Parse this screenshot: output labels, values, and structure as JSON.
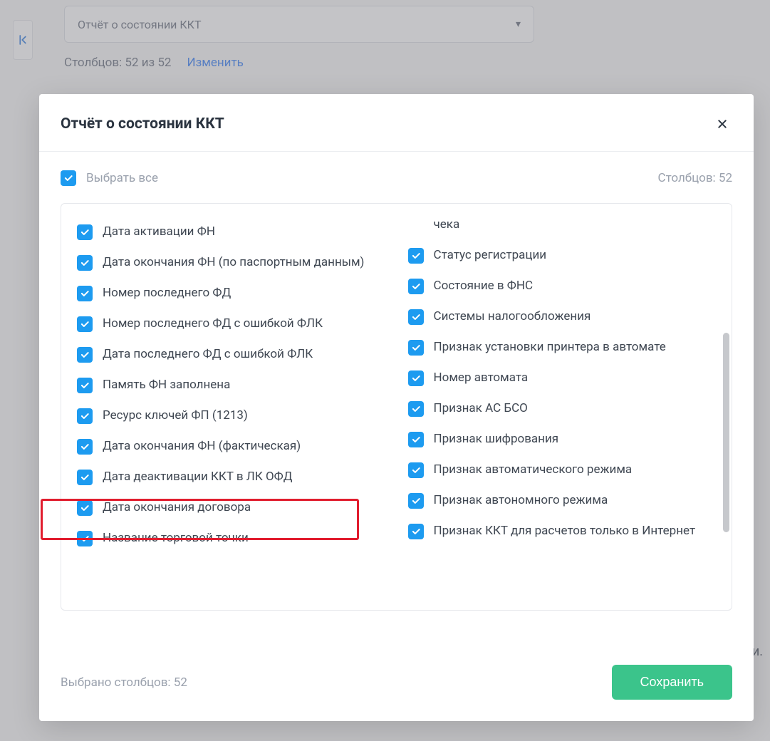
{
  "bg": {
    "dropdown_label": "Отчёт о состоянии ККТ",
    "columns_count": "Столбцов: 52 из 52",
    "change_link": "Изменить",
    "trailing": "и."
  },
  "modal": {
    "title": "Отчёт о состоянии ККТ",
    "select_all": "Выбрать все",
    "columns_header": "Столбцов: 52",
    "selected_footer": "Выбрано столбцов: 52",
    "save": "Сохранить"
  },
  "left_items": [
    "Дата активации ФН",
    "Дата окончания ФН (по паспортным данным)",
    "Номер последнего ФД",
    "Номер последнего ФД с ошибкой ФЛК",
    "Дата последнего ФД с ошибкой ФЛК",
    "Память ФН заполнена",
    "Ресурс ключей ФП (1213)",
    "Дата окончания ФН (фактическая)",
    "Дата деактивации ККТ в ЛК ОФД",
    "Дата окончания договора",
    "Название торговой точки"
  ],
  "right_top": "чека",
  "right_items": [
    "Статус регистрации",
    "Состояние в ФНС",
    "Системы налогообложения",
    "Признак установки принтера в автомате",
    "Номер автомата",
    "Признак АС БСО",
    "Признак шифрования",
    "Признак автоматического режима",
    "Признак автономного режима",
    "Признак ККТ для расчетов только в Интернет"
  ]
}
